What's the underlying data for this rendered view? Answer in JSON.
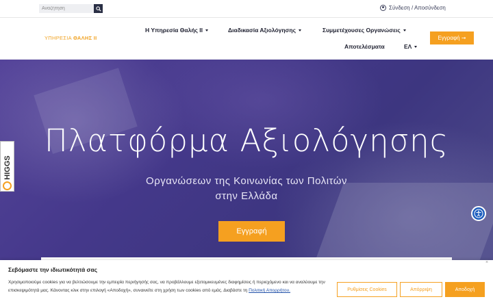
{
  "topbar": {
    "search_placeholder": "Αναζήτηση",
    "login_label": "Σύνδεση / Αποσύνδεση"
  },
  "header": {
    "logo_prefix": "ΥΠΗΡΕΣΙΑ ",
    "logo_bold": "ΘΑΛΗΣ ΙΙ",
    "nav": [
      {
        "label": "Η Υπηρεσία Θαλής ΙΙ",
        "dropdown": true
      },
      {
        "label": "Διαδικασία Αξιολόγησης",
        "dropdown": true
      },
      {
        "label": "Συμμετέχουσες Οργανώσεις",
        "dropdown": true
      },
      {
        "label": "Αποτελέσματα",
        "dropdown": false
      },
      {
        "label": "ΕΛ",
        "dropdown": true
      }
    ],
    "register_label": "Εγγραφή ➞"
  },
  "hero": {
    "title": "Πλατφόρμα Αξιολόγησης",
    "subtitle_line1": "Οργανώσεων της Κοινωνίας των Πολιτών",
    "subtitle_line2": "στην Ελλάδα",
    "button_label": "Εγγραφή",
    "badge_text": "HIGGS"
  },
  "cookie": {
    "title": "Σεβόμαστε την ιδιωτικότητά σας",
    "text": "Χρησιμοποιούμε cookies για να βελτιώσουμε την εμπειρία περιήγησής σας, να προβάλλουμε εξατομικευμένες διαφημίσεις ή περιεχόμενο και να αναλύουμε την επισκεψιμότητά μας. Κάνοντας κλικ στην επιλογή «Αποδοχή», συναινείτε στη χρήση των cookies από εμάς. Διαβάστε τη ",
    "link": "Πολιτική Απορρήτου.",
    "settings_label": "Ρυθμίσεις Cookies",
    "reject_label": "Απόρριψη",
    "accept_label": "Αποδοχή",
    "close_label": "×"
  },
  "colors": {
    "accent": "#f5a020",
    "dark_navy": "#2a2f45",
    "hero_overlay": "#44388a",
    "access_blue": "#1f5fbf"
  },
  "icons": [
    "search-icon",
    "user-icon",
    "caret-down-icon",
    "arrow-right-icon",
    "accessibility-icon",
    "close-icon"
  ]
}
